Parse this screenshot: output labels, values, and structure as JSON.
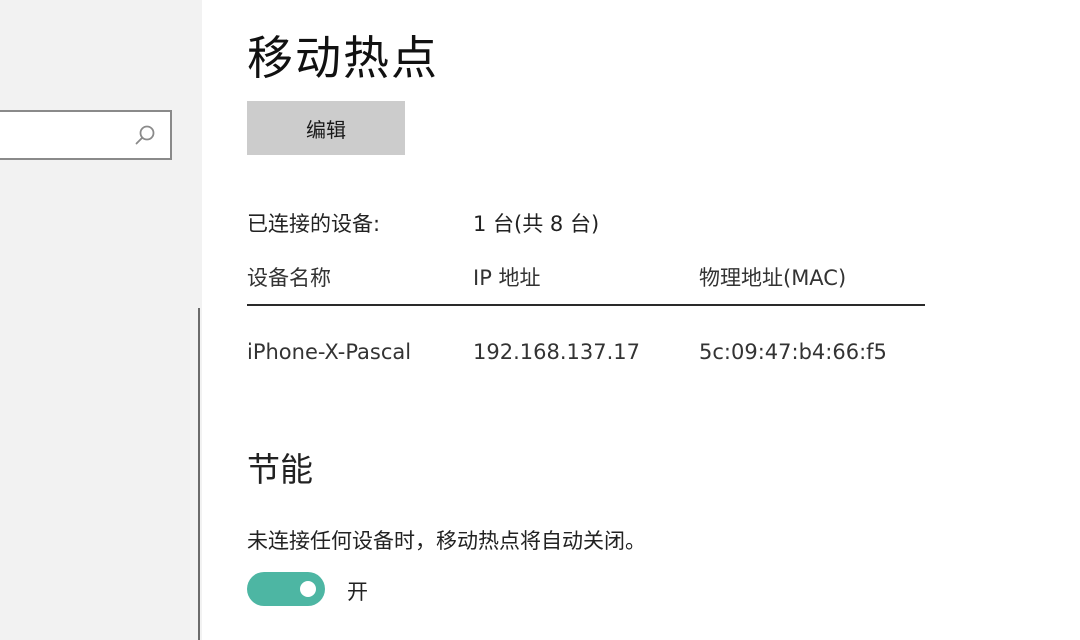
{
  "sidebar": {
    "search": {
      "placeholder": ""
    }
  },
  "main": {
    "title": "移动热点",
    "edit_label": "编辑",
    "connected": {
      "label": "已连接的设备:",
      "value": "1 台(共 8 台)"
    },
    "table": {
      "headers": [
        "设备名称",
        "IP 地址",
        "物理地址(MAC)"
      ],
      "rows": [
        [
          "iPhone-X-Pascal",
          "192.168.137.17",
          "5c:09:47:b4:66:f5"
        ]
      ]
    },
    "power_saving": {
      "title": "节能",
      "description": "未连接任何设备时，移动热点将自动关闭。",
      "toggle_state": "开",
      "toggle_on": true,
      "accent_color": "#4db6a3"
    }
  },
  "icons": [
    "search-icon"
  ]
}
